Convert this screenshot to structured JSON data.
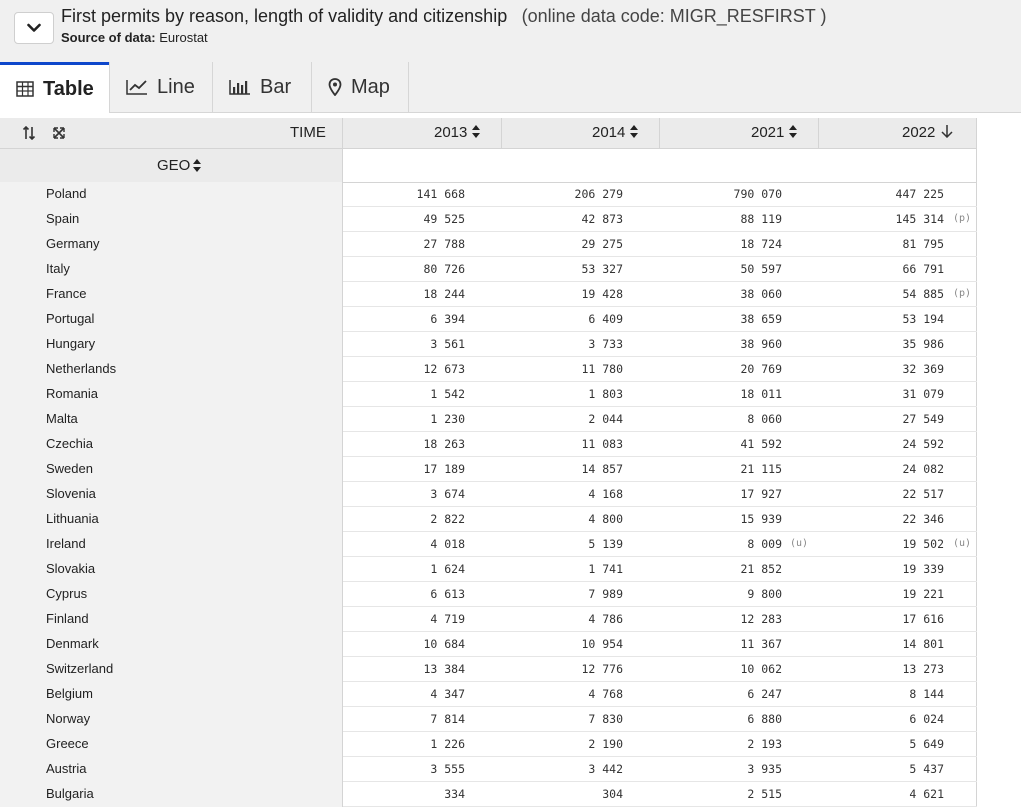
{
  "header": {
    "title": "First permits by reason, length of validity and citizenship",
    "code": "(online data code: MIGR_RESFIRST )",
    "source_label": "Source of data:",
    "source_value": "Eurostat"
  },
  "tabs": [
    {
      "label": "Table",
      "icon": "table-icon",
      "active": true
    },
    {
      "label": "Line",
      "icon": "line-chart-icon"
    },
    {
      "label": "Bar",
      "icon": "bar-chart-icon"
    },
    {
      "label": "Map",
      "icon": "map-pin-icon"
    }
  ],
  "table": {
    "time_label": "TIME",
    "geo_label": "GEO",
    "columns": [
      "2013",
      "2014",
      "2021",
      "2022"
    ],
    "rows": [
      {
        "geo": "Poland",
        "values": [
          "141 668",
          "206 279",
          "790 070",
          "447 225"
        ],
        "flags": [
          "",
          "",
          "",
          ""
        ]
      },
      {
        "geo": "Spain",
        "values": [
          "49 525",
          "42 873",
          "88 119",
          "145 314"
        ],
        "flags": [
          "",
          "",
          "",
          "(p)"
        ]
      },
      {
        "geo": "Germany",
        "values": [
          "27 788",
          "29 275",
          "18 724",
          "81 795"
        ],
        "flags": [
          "",
          "",
          "",
          ""
        ]
      },
      {
        "geo": "Italy",
        "values": [
          "80 726",
          "53 327",
          "50 597",
          "66 791"
        ],
        "flags": [
          "",
          "",
          "",
          ""
        ]
      },
      {
        "geo": "France",
        "values": [
          "18 244",
          "19 428",
          "38 060",
          "54 885"
        ],
        "flags": [
          "",
          "",
          "",
          "(p)"
        ]
      },
      {
        "geo": "Portugal",
        "values": [
          "6 394",
          "6 409",
          "38 659",
          "53 194"
        ],
        "flags": [
          "",
          "",
          "",
          ""
        ]
      },
      {
        "geo": "Hungary",
        "values": [
          "3 561",
          "3 733",
          "38 960",
          "35 986"
        ],
        "flags": [
          "",
          "",
          "",
          ""
        ]
      },
      {
        "geo": "Netherlands",
        "values": [
          "12 673",
          "11 780",
          "20 769",
          "32 369"
        ],
        "flags": [
          "",
          "",
          "",
          ""
        ]
      },
      {
        "geo": "Romania",
        "values": [
          "1 542",
          "1 803",
          "18 011",
          "31 079"
        ],
        "flags": [
          "",
          "",
          "",
          ""
        ]
      },
      {
        "geo": "Malta",
        "values": [
          "1 230",
          "2 044",
          "8 060",
          "27 549"
        ],
        "flags": [
          "",
          "",
          "",
          ""
        ]
      },
      {
        "geo": "Czechia",
        "values": [
          "18 263",
          "11 083",
          "41 592",
          "24 592"
        ],
        "flags": [
          "",
          "",
          "",
          ""
        ]
      },
      {
        "geo": "Sweden",
        "values": [
          "17 189",
          "14 857",
          "21 115",
          "24 082"
        ],
        "flags": [
          "",
          "",
          "",
          ""
        ]
      },
      {
        "geo": "Slovenia",
        "values": [
          "3 674",
          "4 168",
          "17 927",
          "22 517"
        ],
        "flags": [
          "",
          "",
          "",
          ""
        ]
      },
      {
        "geo": "Lithuania",
        "values": [
          "2 822",
          "4 800",
          "15 939",
          "22 346"
        ],
        "flags": [
          "",
          "",
          "",
          ""
        ]
      },
      {
        "geo": "Ireland",
        "values": [
          "4 018",
          "5 139",
          "8 009",
          "19 502"
        ],
        "flags": [
          "",
          "",
          "(u)",
          "(u)"
        ]
      },
      {
        "geo": "Slovakia",
        "values": [
          "1 624",
          "1 741",
          "21 852",
          "19 339"
        ],
        "flags": [
          "",
          "",
          "",
          ""
        ]
      },
      {
        "geo": "Cyprus",
        "values": [
          "6 613",
          "7 989",
          "9 800",
          "19 221"
        ],
        "flags": [
          "",
          "",
          "",
          ""
        ]
      },
      {
        "geo": "Finland",
        "values": [
          "4 719",
          "4 786",
          "12 283",
          "17 616"
        ],
        "flags": [
          "",
          "",
          "",
          ""
        ]
      },
      {
        "geo": "Denmark",
        "values": [
          "10 684",
          "10 954",
          "11 367",
          "14 801"
        ],
        "flags": [
          "",
          "",
          "",
          ""
        ]
      },
      {
        "geo": "Switzerland",
        "values": [
          "13 384",
          "12 776",
          "10 062",
          "13 273"
        ],
        "flags": [
          "",
          "",
          "",
          ""
        ]
      },
      {
        "geo": "Belgium",
        "values": [
          "4 347",
          "4 768",
          "6 247",
          "8 144"
        ],
        "flags": [
          "",
          "",
          "",
          ""
        ]
      },
      {
        "geo": "Norway",
        "values": [
          "7 814",
          "7 830",
          "6 880",
          "6 024"
        ],
        "flags": [
          "",
          "",
          "",
          ""
        ]
      },
      {
        "geo": "Greece",
        "values": [
          "1 226",
          "2 190",
          "2 193",
          "5 649"
        ],
        "flags": [
          "",
          "",
          "",
          ""
        ]
      },
      {
        "geo": "Austria",
        "values": [
          "3 555",
          "3 442",
          "3 935",
          "5 437"
        ],
        "flags": [
          "",
          "",
          "",
          ""
        ]
      },
      {
        "geo": "Bulgaria",
        "values": [
          "334",
          "304",
          "2 515",
          "4 621"
        ],
        "flags": [
          "",
          "",
          "",
          ""
        ]
      }
    ]
  },
  "colors": {
    "accent": "#0e47cb",
    "header_bg": "#f0f0f0",
    "table_header_bg": "#ebebeb"
  }
}
